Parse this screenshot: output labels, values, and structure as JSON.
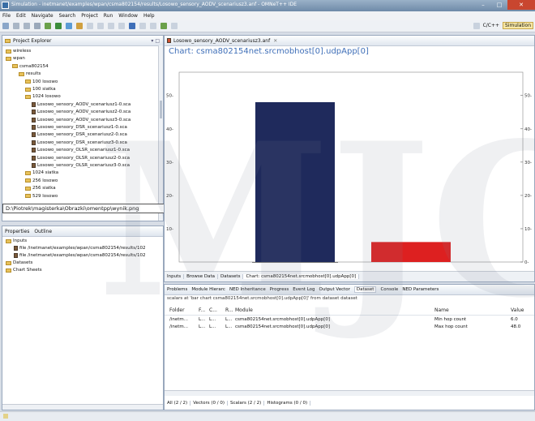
{
  "window": {
    "title": "Simulation - inetmanet/examples/wpan/csma802154/results/Losowo_sensory_AODV_scenariusz3.anf - OMNeT++ IDE"
  },
  "menu": [
    "File",
    "Edit",
    "Navigate",
    "Search",
    "Project",
    "Run",
    "Window",
    "Help"
  ],
  "perspectives": {
    "cpp": "C/C++",
    "sim": "Simulation"
  },
  "project_explorer": {
    "title": "Project Explorer",
    "items": [
      {
        "label": "wireless",
        "type": "folder",
        "level": 0
      },
      {
        "label": "wpan",
        "type": "folder",
        "level": 0
      },
      {
        "label": "csma802154",
        "type": "folder",
        "level": 1
      },
      {
        "label": "results",
        "type": "folder",
        "level": 2
      },
      {
        "label": "100 losowo",
        "type": "folder",
        "level": 3
      },
      {
        "label": "100 siatka",
        "type": "folder",
        "level": 3
      },
      {
        "label": "1024 losowo",
        "type": "folder",
        "level": 3
      },
      {
        "label": "Losowo_sensory_AODV_scenariusz1-0.sca",
        "type": "file",
        "level": 4
      },
      {
        "label": "Losowo_sensory_AODV_scenariusz2-0.sca",
        "type": "file",
        "level": 4
      },
      {
        "label": "Losowo_sensory_AODV_scenariusz3-0.sca",
        "type": "file",
        "level": 4
      },
      {
        "label": "Losowo_sensory_DSR_scenariusz1-0.sca",
        "type": "file",
        "level": 4
      },
      {
        "label": "Losowo_sensory_DSR_scenariusz2-0.sca",
        "type": "file",
        "level": 4
      },
      {
        "label": "Losowo_sensory_DSR_scenariusz3-0.sca",
        "type": "file",
        "level": 4
      },
      {
        "label": "Losowo_sensory_OLSR_scenariusz1-0.sca",
        "type": "file",
        "level": 4
      },
      {
        "label": "Losowo_sensory_OLSR_scenariusz2-0.sca",
        "type": "file",
        "level": 4
      },
      {
        "label": "Losowo_sensory_OLSR_scenariusz3-0.sca",
        "type": "file",
        "level": 4
      },
      {
        "label": "1024 siatka",
        "type": "folder",
        "level": 3
      },
      {
        "label": "256 losowo",
        "type": "folder",
        "level": 3
      },
      {
        "label": "256 siatka",
        "type": "folder",
        "level": 3
      },
      {
        "label": "529 losowo",
        "type": "folder",
        "level": 3
      }
    ]
  },
  "tooltip": "D:\\Piotrek\\magisterka\\Obrazki\\omentpp\\wynik.png",
  "outline": {
    "tabs": [
      "Properties",
      "Outline"
    ],
    "items": [
      {
        "label": "Inputs",
        "type": "folder",
        "level": 0
      },
      {
        "label": "file /inetmanet/examples/wpan/csma802154/results/102",
        "type": "file",
        "level": 1
      },
      {
        "label": "file /inetmanet/examples/wpan/csma802154/results/102",
        "type": "file",
        "level": 1
      },
      {
        "label": "Datasets",
        "type": "folder",
        "level": 0
      },
      {
        "label": "Chart Sheets",
        "type": "folder",
        "level": 0
      }
    ]
  },
  "editor": {
    "tab": "Losowo_sensory_AODV_scenariusz3.anf",
    "bottom_tabs": [
      "Inputs",
      "Browse Data",
      "Datasets",
      "Chart: csma802154net.srcmobhost[0].udpApp[0]"
    ]
  },
  "chart_data": {
    "type": "bar",
    "title": "Chart: csma802154net.srcmobhost[0].udpApp[0]",
    "categories": [
      "Min hop count",
      "Max hop count"
    ],
    "values": [
      48.0,
      6.0
    ],
    "colors": [
      "#1f2a5c",
      "#dd2020"
    ],
    "ylim": [
      0,
      57
    ],
    "yticks": [
      0,
      10,
      20,
      30,
      40,
      50
    ],
    "ytick_labels": [
      "0-",
      "10-",
      "20-",
      "30-",
      "40-",
      "50-"
    ],
    "left_tick_labels": [
      "50-",
      "40-",
      "30-",
      "20-",
      "10-"
    ],
    "grid": false
  },
  "bottom_panel": {
    "tabs": [
      "Problems",
      "Module Hierarc",
      "NED Inheritance",
      "Progress",
      "Event Log",
      "Output Vector",
      "Dataset",
      "Console",
      "NED Parameters"
    ],
    "status": "scalars at 'bar chart csma802154net.srcmobhost[0].udpApp[0]' from dataset dataset",
    "columns": [
      "Folder",
      "F...",
      "C...",
      "R...",
      "Module",
      "Name",
      "Value"
    ],
    "rows": [
      [
        "/inetm...",
        "L...",
        "L...",
        "L...",
        "csma802154net.srcmobhost[0].udpApp[0]",
        "Min hop count",
        "6.0"
      ],
      [
        "/inetm...",
        "L...",
        "L...",
        "L...",
        "csma802154net.srcmobhost[0].udpApp[0]",
        "Max hop count",
        "48.0"
      ]
    ],
    "filter_tabs": [
      "All (2 / 2)",
      "Vectors (0 / 0)",
      "Scalars (2 / 2)",
      "Histograms (0 / 0)"
    ]
  }
}
